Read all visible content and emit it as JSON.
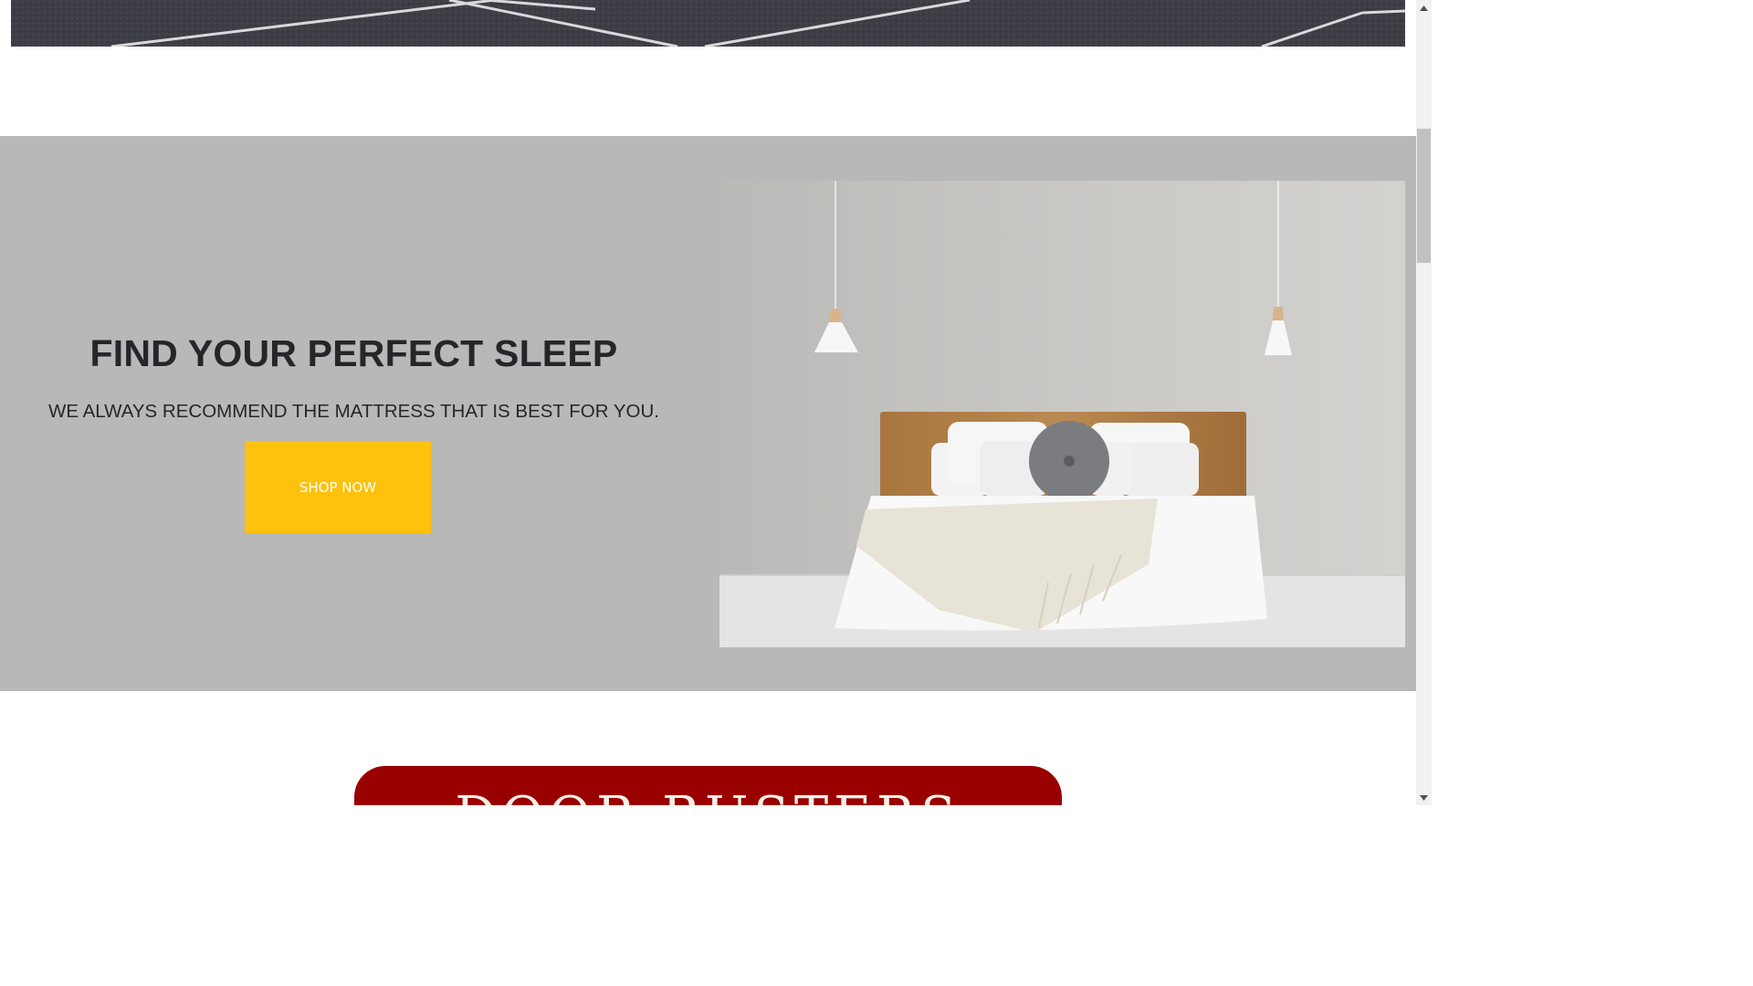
{
  "promo": {
    "title": "FIND YOUR PERFECT SLEEP",
    "subtitle": "WE ALWAYS RECOMMEND THE MATTRESS THAT IS BEST FOR YOU.",
    "button_label": "SHOP NOW",
    "button_color": "#fec20c",
    "background_color": "#b8b8b8"
  },
  "door_busters": {
    "title": "DOOR BUSTERS",
    "background_color": "#990000"
  },
  "icons": {
    "scroll_up": "arrow-up-icon",
    "scroll_down": "arrow-down-icon"
  }
}
